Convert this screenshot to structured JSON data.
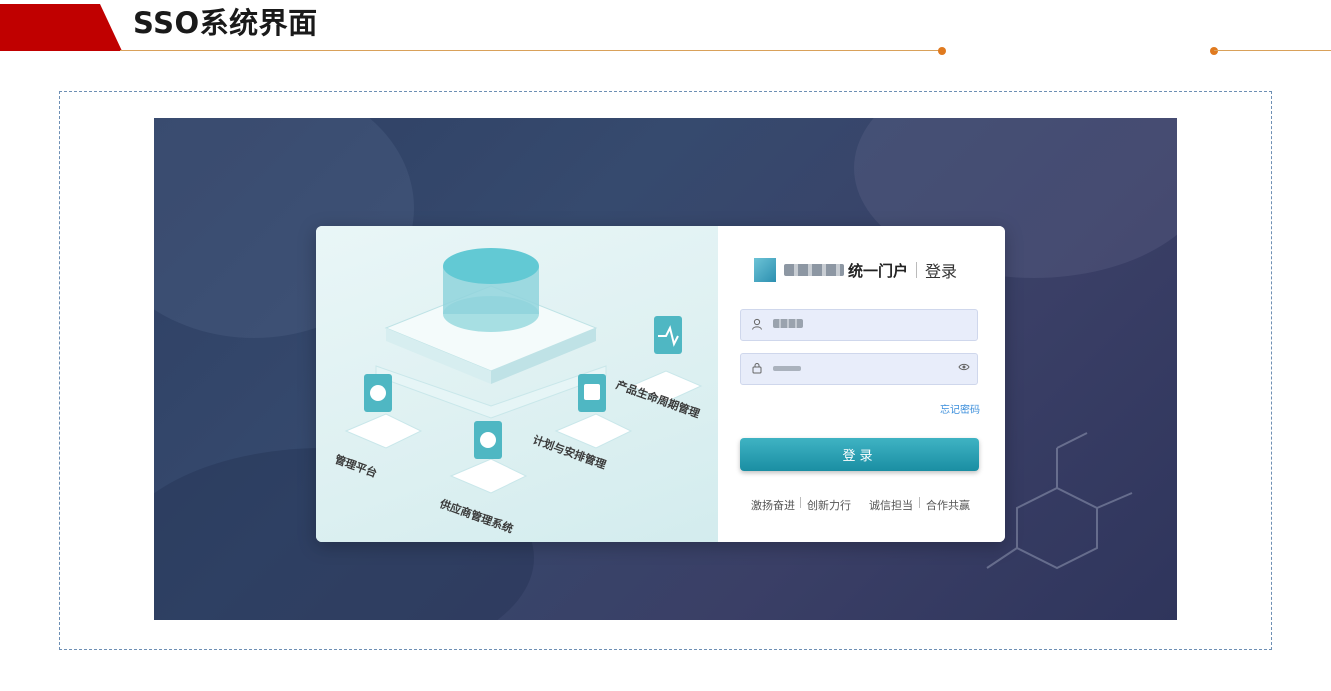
{
  "slide": {
    "title": "SSO系统界面"
  },
  "colors": {
    "accent_red": "#c00000",
    "rule_orange": "#e07a1f",
    "button_teal": "#1a8ea3",
    "link_blue": "#3a8edb",
    "input_bg": "#e8edfa"
  },
  "login": {
    "portal_name": "统一门户",
    "title": "登录",
    "forgot_password": "忘记密码",
    "submit_label": "登录",
    "slogans": [
      "激扬奋进",
      "创新力行",
      "诚信担当",
      "合作共赢"
    ]
  },
  "illustration": {
    "labels": {
      "product_lifecycle": "产品生命周期管理",
      "planning": "计划与安排管理",
      "supplier": "供应商管理系统",
      "platform": "管理平台"
    }
  },
  "icons": {
    "user": "user-icon",
    "lock": "lock-icon",
    "eye": "eye-icon"
  }
}
